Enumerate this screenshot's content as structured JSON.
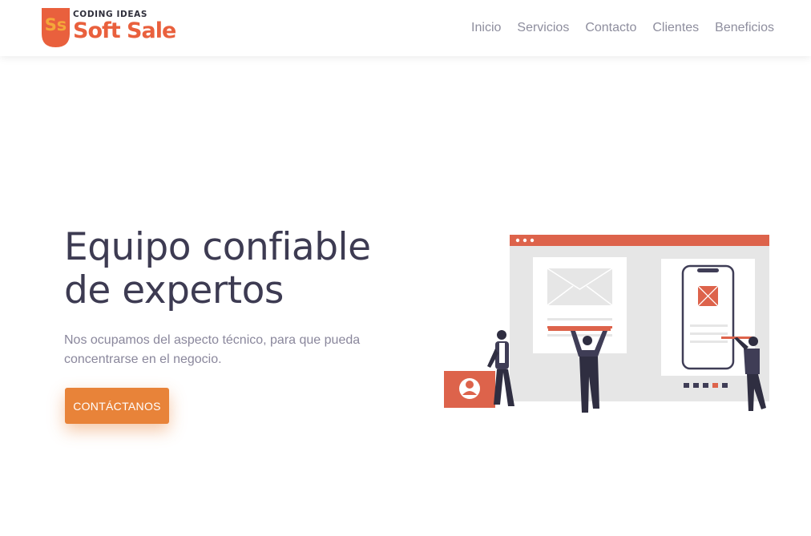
{
  "header": {
    "logo": {
      "tagline": "CODING IDEAS",
      "name": "Soft Sale",
      "mark": "Ss",
      "colors": {
        "primary": "#e9603d",
        "secondary": "#f4a73a"
      }
    },
    "nav": [
      {
        "label": "Inicio"
      },
      {
        "label": "Servicios"
      },
      {
        "label": "Contacto"
      },
      {
        "label": "Clientes"
      },
      {
        "label": "Beneficios"
      }
    ]
  },
  "hero": {
    "title": "Equipo confiable de expertos",
    "subtitle": "Nos ocupamos del aspecto técnico, para que pueda concentrarse en el negocio.",
    "cta_label": "CONTÁCTANOS",
    "accent_color": "#e88339"
  },
  "illustration": {
    "icons": [
      "browser-window-icon",
      "mail-envelope-icon",
      "smartphone-icon",
      "user-profile-icon",
      "person-figure-icon"
    ],
    "colors": {
      "accent": "#dd634b",
      "panel": "#e6e6e6",
      "figure": "#3f3d56"
    }
  }
}
